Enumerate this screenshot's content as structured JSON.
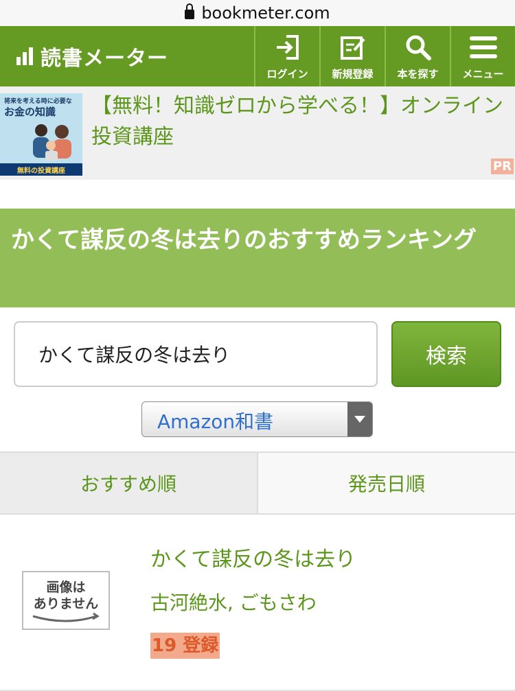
{
  "browser": {
    "domain": "bookmeter.com"
  },
  "header": {
    "logo": "読書メーター",
    "nav": [
      {
        "label": "ログイン",
        "icon": "login-icon"
      },
      {
        "label": "新規登録",
        "icon": "register-icon"
      },
      {
        "label": "本を探す",
        "icon": "search-icon"
      },
      {
        "label": "メニュー",
        "icon": "menu-icon"
      }
    ],
    "accent": "#659b22"
  },
  "ad": {
    "thumb_line1": "将来を考える時に必要な",
    "thumb_line2": "お金の知識",
    "thumb_band": "無料の投資講座",
    "text": "【無料！知識ゼロから学べる！】オンライン投資講座",
    "badge": "PR"
  },
  "page": {
    "title": "かくて謀反の冬は去りのおすすめランキング"
  },
  "search": {
    "value": "かくて謀反の冬は去り",
    "button": "検索",
    "source_selected": "Amazon和書"
  },
  "sort": {
    "tabs": [
      "おすすめ順",
      "発売日順"
    ],
    "active": 0
  },
  "results": [
    {
      "title": "かくて謀反の冬は去り",
      "author": "古河絶水, ごもさわ",
      "count": "19 登録",
      "cover_text_1": "画像は",
      "cover_text_2": "ありません"
    }
  ]
}
